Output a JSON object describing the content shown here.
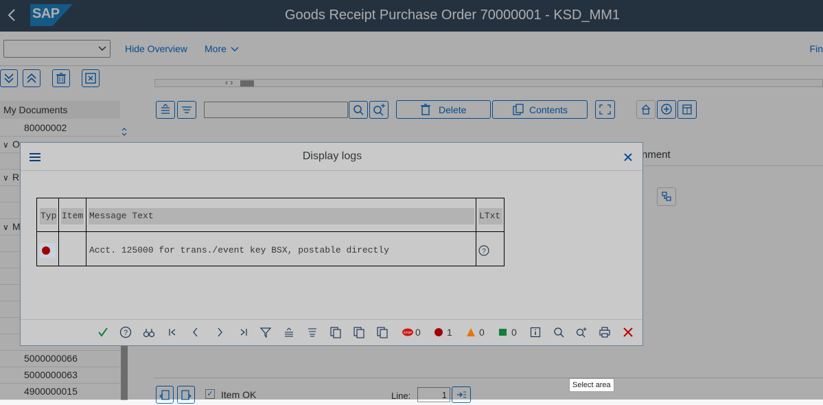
{
  "shell": {
    "logo": "SAP",
    "title": "Goods Receipt Purchase Order 70000001 - KSD_MM1"
  },
  "toolbar": {
    "select_value": "",
    "hide_overview": "Hide Overview",
    "more": "More",
    "find": "Fin"
  },
  "left_panel": {
    "header": "My Documents",
    "rows": [
      {
        "toggle": "",
        "label": "80000002"
      },
      {
        "toggle": "∨",
        "label": "O"
      },
      {
        "toggle": "",
        "label": ""
      },
      {
        "toggle": "∨",
        "label": "R"
      },
      {
        "toggle": "",
        "label": ""
      },
      {
        "toggle": "",
        "label": ""
      },
      {
        "toggle": "∨",
        "label": "M"
      },
      {
        "toggle": "",
        "label": ""
      },
      {
        "toggle": "",
        "label": ""
      },
      {
        "toggle": "",
        "label": ""
      },
      {
        "toggle": "",
        "label": ""
      },
      {
        "toggle": "",
        "label": ""
      },
      {
        "toggle": "",
        "label": ""
      },
      {
        "toggle": "",
        "label": ""
      },
      {
        "toggle": "",
        "label": "5000000066"
      },
      {
        "toggle": "",
        "label": "5000000063"
      },
      {
        "toggle": "",
        "label": "4900000015"
      }
    ]
  },
  "content": {
    "delete_label": "Delete",
    "contents_label": "Contents",
    "assignment_label": "nment",
    "item_ok_label": "Item OK",
    "line_label": "Line:",
    "line_value": "1"
  },
  "dialog": {
    "title": "Display logs",
    "columns": [
      "Typ",
      "Item",
      "Message Text",
      "LTxt"
    ],
    "rows": [
      {
        "type": "error",
        "item": "",
        "message": "Acct. 125000 for trans./event key BSX, postable directly",
        "ltxt": "?"
      }
    ],
    "counts": {
      "stop": "0",
      "error": "1",
      "warning": "0",
      "success": "0"
    }
  },
  "tooltip": "Select area",
  "colors": {
    "shell": "#354a5f",
    "accent": "#0a6ed1",
    "error": "#a00000",
    "warning": "#e9730c",
    "success": "#107e3e",
    "confirm": "#107e3e",
    "cancel": "#bb0000"
  }
}
